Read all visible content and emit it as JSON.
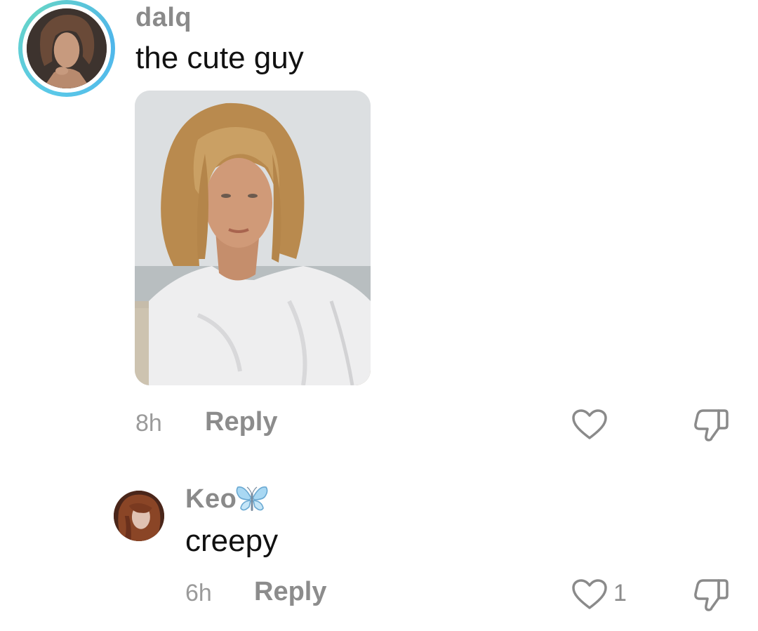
{
  "comment": {
    "username": "dalq",
    "text": "the cute guy",
    "time": "8h",
    "reply_label": "Reply",
    "like_icon": "heart-outline-icon",
    "dislike_icon": "thumbs-down-icon"
  },
  "reply": {
    "username": "Keo",
    "username_emoji": "butterfly-icon",
    "text": "creepy",
    "time": "6h",
    "reply_label": "Reply",
    "likes": "1",
    "like_icon": "heart-outline-icon",
    "dislike_icon": "thumbs-down-icon"
  },
  "colors": {
    "ring_accent": "#5ac8e8",
    "meta_gray": "#8c8c8c",
    "text": "#111111"
  }
}
